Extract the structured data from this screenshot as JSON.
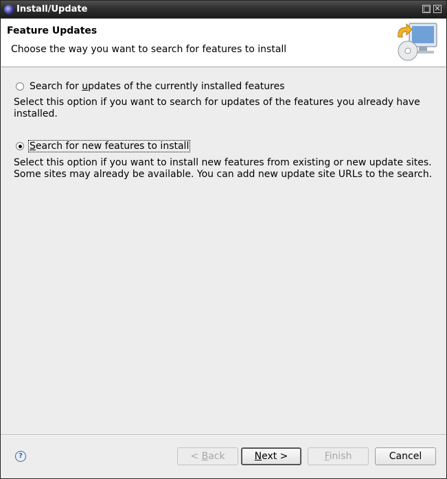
{
  "window": {
    "title": "Install/Update",
    "app_icon": "eclipse-icon"
  },
  "header": {
    "title": "Feature Updates",
    "description": "Choose the way you want to search for features to install",
    "icon": "install-wizard-icon"
  },
  "options": [
    {
      "label_pre": "Search for ",
      "label_mnemonic": "u",
      "label_post": "pdates of the currently installed features",
      "description": "Select this option if you want to search for updates of the features you already have installed.",
      "selected": false
    },
    {
      "label_pre": "",
      "label_mnemonic": "S",
      "label_post": "earch for new features to install",
      "description": "Select this option if you want to install new features from existing or new update sites. Some sites may already be available. You can add new update site URLs to the search.",
      "selected": true
    }
  ],
  "buttons": {
    "back": {
      "mnemonic": "B",
      "pre": "< ",
      "post": "ack"
    },
    "next": {
      "mnemonic": "N",
      "pre": "",
      "post": "ext >"
    },
    "finish": {
      "mnemonic": "F",
      "pre": "",
      "post": "inish"
    },
    "cancel": {
      "label": "Cancel"
    }
  },
  "help_icon": "help-icon"
}
